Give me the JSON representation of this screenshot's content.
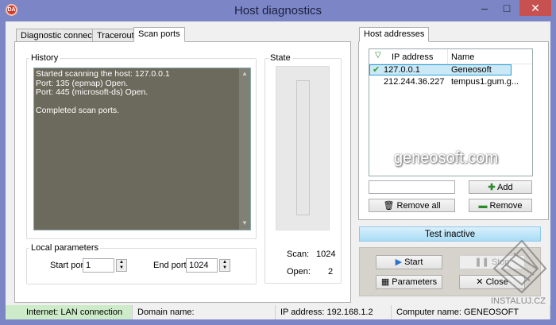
{
  "window": {
    "title": "Host diagnostics",
    "icon_text": "DA",
    "minimize": "–",
    "maximize": "□",
    "close": "✕"
  },
  "tabs": [
    {
      "label": "Diagnostic connection"
    },
    {
      "label": "Traceroute"
    },
    {
      "label": "Scan ports"
    }
  ],
  "history": {
    "label": "History",
    "lines": [
      "Started scanning the host: 127.0.0.1",
      "Port: 135 (epmap) Open.",
      "Port: 445 (microsoft-ds) Open.",
      "",
      "Completed scan ports."
    ]
  },
  "state": {
    "label": "State",
    "progress": 0,
    "scan_label": "Scan:",
    "scan_value": "1024",
    "open_label": "Open:",
    "open_value": "2"
  },
  "local_params": {
    "label": "Local parameters",
    "start_label": "Start port:",
    "start_value": "1",
    "end_label": "End port:",
    "end_value": "1024"
  },
  "hosts": {
    "tab": "Host addresses",
    "columns": [
      "IP address",
      "Name"
    ],
    "rows": [
      {
        "ip": "127.0.0.1",
        "name": "Geneosoft",
        "selected": true
      },
      {
        "ip": "212.244.36.227",
        "name": "tempus1.gum.g..."
      }
    ],
    "input_value": "",
    "add": "Add",
    "remove_all": "Remove all",
    "remove": "Remove"
  },
  "test_status": "Test inactive",
  "controls": {
    "start": "Start",
    "stop": "Stop",
    "parameters": "Parameters",
    "close": "Close"
  },
  "statusbar": {
    "internet": "Internet: LAN connection",
    "domain": "Domain name:",
    "ip": "IP address: 192.168.1.2",
    "computer": "Computer name: GENEOSOFT"
  },
  "watermark": {
    "logo_text": "geneosoft.com",
    "site": "INSTALUJ.CZ"
  },
  "colors": {
    "accent": "#7c86c6",
    "history_bg": "#6c6a5c",
    "test_bar": "#bfe6f8",
    "internet_ok": "#cdebc8"
  }
}
